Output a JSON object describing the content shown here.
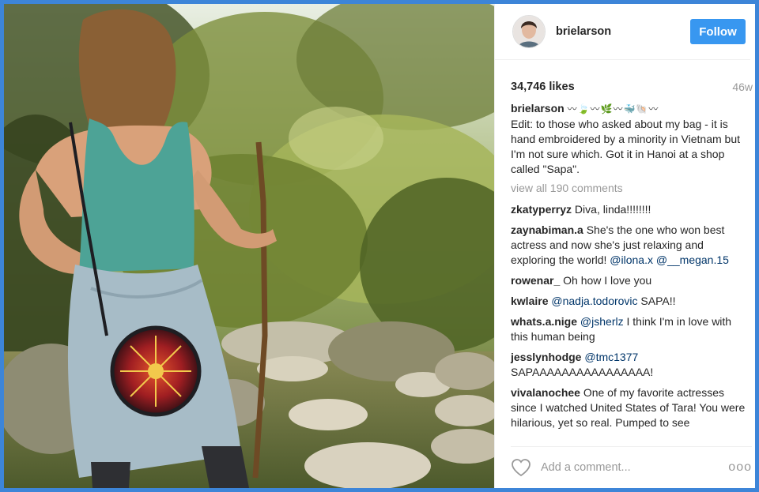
{
  "post": {
    "username": "brielarson",
    "follow_label": "Follow",
    "likes": "34,746 likes",
    "age": "46w",
    "photo_alt": "forest-river-photo"
  },
  "caption": {
    "user": "brielarson",
    "emoji": "〰🍃〰🌿〰🐳🐚〰",
    "text": "Edit: to those who asked about my bag - it is hand embroidered by a minority in Vietnam but I'm not sure which. Got it in Hanoi at a shop called \"Sapa\"."
  },
  "view_all": "view all 190 comments",
  "comments": [
    {
      "user": "zkatyperryz",
      "parts": [
        {
          "t": " Diva, linda!!!!!!!!"
        }
      ]
    },
    {
      "user": "zaynabiman.a",
      "parts": [
        {
          "t": " She's the one who won best actress and now she's just relaxing and exploring the world! "
        },
        {
          "m": "@ilona.x"
        },
        {
          "t": " "
        },
        {
          "m": "@__megan.15"
        }
      ]
    },
    {
      "user": "rowenar_",
      "parts": [
        {
          "t": " Oh how I love you"
        }
      ]
    },
    {
      "user": "kwlaire",
      "parts": [
        {
          "t": " "
        },
        {
          "m": "@nadja.todorovic"
        },
        {
          "t": " SAPA!!"
        }
      ]
    },
    {
      "user": "whats.a.nige",
      "parts": [
        {
          "t": " "
        },
        {
          "m": "@jsherlz"
        },
        {
          "t": " I think I'm in love with this human being"
        }
      ]
    },
    {
      "user": "jesslynhodge",
      "parts": [
        {
          "t": " "
        },
        {
          "m": "@tmc1377"
        },
        {
          "t": " SAPAAAAAAAAAAAAAAAA!"
        }
      ]
    },
    {
      "user": "vivalanochee",
      "parts": [
        {
          "t": " One of my favorite actresses since I watched United States of Tara! You were hilarious, yet so real. Pumped to see"
        }
      ]
    }
  ],
  "footer": {
    "placeholder": "Add a comment...",
    "more": "ooo"
  },
  "colors": {
    "follow": "#3897f0",
    "border": "#3d85d8",
    "mention": "#003569"
  }
}
